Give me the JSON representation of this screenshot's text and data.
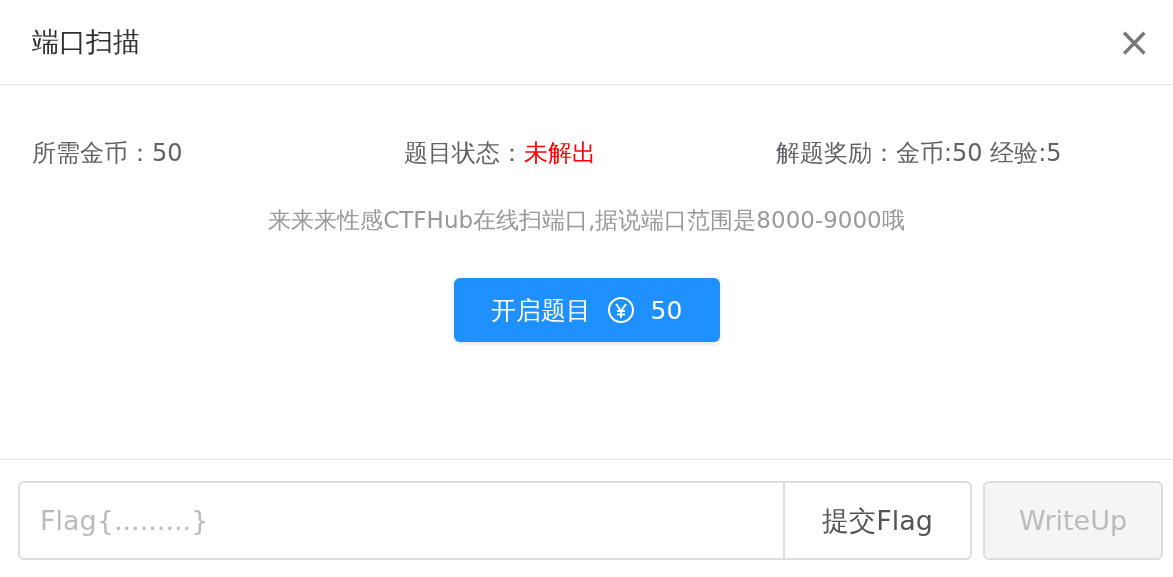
{
  "dialog": {
    "title": "端口扫描",
    "close": "×"
  },
  "info": [
    {
      "kind": "plain",
      "label": "所需金币：",
      "value": "50"
    },
    {
      "kind": "status",
      "label": "题目状态：",
      "value": "未解出",
      "solved": false
    },
    {
      "kind": "plain",
      "label": "解题奖励：",
      "value": "金币:50 经验:5"
    }
  ],
  "description": "来来来性感CTFHub在线扫端口,据说端口范围是8000-9000哦",
  "start_button": {
    "label": "开启题目",
    "cost": "50"
  },
  "flag_field": {
    "placeholder": "Flag{.........}"
  },
  "submit_button": {
    "label": "提交Flag"
  },
  "writeup_button": {
    "label": "WriteUp",
    "disabled": true
  }
}
